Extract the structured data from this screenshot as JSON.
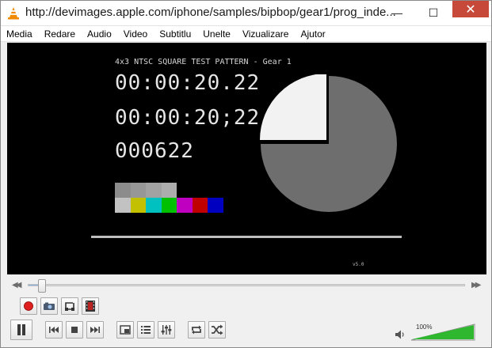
{
  "window": {
    "title": "http://devimages.apple.com/iphone/samples/bipbop/gear1/prog_inde...",
    "controls": {
      "minimize": "—",
      "maximize": "☐",
      "close": "✕"
    }
  },
  "menu": [
    "Media",
    "Redare",
    "Audio",
    "Video",
    "Subtitlu",
    "Unelte",
    "Vizualizare",
    "Ajutor"
  ],
  "video": {
    "header_text": "4x3 NTSC SQUARE TEST PATTERN - Gear 1",
    "timecode_1": "00:00:20.22",
    "timecode_2": "00:00:20;22",
    "frame_count": "000622",
    "footer_text": "v5.0",
    "pie_filled_fraction": 0.75,
    "swatch_grays": [
      "#8c8c8c",
      "#979797",
      "#a2a2a2",
      "#adadad"
    ],
    "swatch_colors": [
      "#c2c2c2",
      "#c2c000",
      "#00c0c0",
      "#00c000",
      "#c000c0",
      "#c00000",
      "#0000c0"
    ],
    "pie_colors": {
      "filled": "#6e6e6e",
      "open": "#f2f2f2"
    }
  },
  "playback": {
    "position_fraction": 0.03
  },
  "volume": {
    "label": "100%",
    "level_fraction": 1.0,
    "bar_color": "#2fb82f"
  },
  "icons": {
    "record": "record-icon",
    "snapshot": "snapshot-icon",
    "loop_ab": "loop-ab-icon",
    "frame_step": "frame-step-icon",
    "pause": "pause-icon",
    "previous": "previous-icon",
    "stop": "stop-icon",
    "next": "next-icon",
    "fullscreen": "fullscreen-icon",
    "playlist": "playlist-icon",
    "extended_settings": "equalizer-icon",
    "loop": "loop-icon",
    "shuffle": "shuffle-icon",
    "speaker": "speaker-icon"
  }
}
